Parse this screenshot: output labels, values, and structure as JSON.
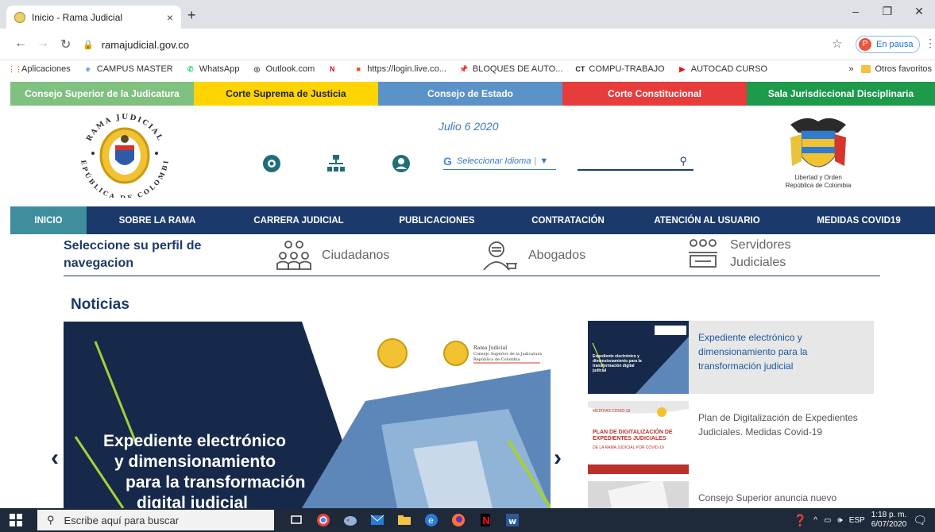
{
  "browser": {
    "tab_title": "Inicio - Rama Judicial",
    "tab_close": "×",
    "new_tab": "+",
    "url": "ramajudicial.gov.co",
    "profile_initial": "P",
    "profile_status": "En pausa",
    "window_controls": {
      "minimize": "–",
      "restore": "❐",
      "close": "✕"
    },
    "bookmarks": [
      {
        "label": "Aplicaciones",
        "icon": "apps-grid-icon",
        "color": "#e65a1e"
      },
      {
        "label": "CAMPUS MASTER",
        "icon": "edge-e-icon",
        "color": "#2a7bd6"
      },
      {
        "label": "WhatsApp",
        "icon": "whatsapp-icon",
        "color": "#25d366"
      },
      {
        "label": "Outlook.com",
        "icon": "globe-icon",
        "color": "#555555"
      },
      {
        "label": "",
        "icon": "netflix-icon",
        "color": "#e50914"
      },
      {
        "label": "https://login.live.co...",
        "icon": "microsoft-icon",
        "color": "#f25022"
      },
      {
        "label": "BLOQUES DE AUTO...",
        "icon": "pin-icon",
        "color": "#999999"
      },
      {
        "label": "COMPU-TRABAJO",
        "icon": "ct-icon",
        "color": "#222222"
      },
      {
        "label": "AUTOCAD CURSO",
        "icon": "youtube-icon",
        "color": "#ff0000"
      }
    ],
    "bookmarks_more": "»",
    "bookmarks_other": "Otros favoritos"
  },
  "corporations": [
    "Consejo Superior de la Judicatura",
    "Corte Suprema de Justicia",
    "Consejo de Estado",
    "Corte Constitucional",
    "Sala Jurisdiccional Disciplinaria"
  ],
  "header": {
    "seal_top_text": "RAMA JUDICIAL",
    "seal_bottom_text": "REPÚBLICA DE COLOMBIA",
    "date": "Julio 6 2020",
    "language_label": "Seleccionar Idioma",
    "language_caret": "▼",
    "escudo_caption_line1": "Libertad y Orden",
    "escudo_caption_line2": "República de Colombia"
  },
  "nav": [
    "INICIO",
    "SOBRE LA RAMA",
    "CARRERA JUDICIAL",
    "PUBLICACIONES",
    "CONTRATACIÓN",
    "ATENCIÓN AL USUARIO",
    "MEDIDAS COVID19"
  ],
  "perfil": {
    "title": "Seleccione su perfil de navegacion",
    "items": [
      "Ciudadanos",
      "Abogados",
      "Servidores Judiciales"
    ]
  },
  "noticias": {
    "title": "Noticias",
    "hero_lines": [
      "Expediente electrónico",
      "y dimensionamiento",
      "para la transformación",
      "digital judicial"
    ],
    "hero_logo_text": "Rama Judicial",
    "hero_logo_subtext": "Consejo Superior de la Judicatura",
    "hero_logo_subtext2": "República de Colombia",
    "prev_arrow": "‹",
    "next_arrow": "›",
    "items": [
      "Expediente electrónico y dimensionamiento para la transformación judicial",
      "Plan de Digitalización de Expedientes Judiciales. Medidas Covid-19",
      "Consejo Superior anuncia nuevo"
    ],
    "thumb1_text": "Expediente electrónico y dimensionamiento para la transformación digital judicial",
    "thumb2_small": "MEDIDAS COVID-19",
    "thumb2_text": "PLAN DE DIGITALIZACIÓN DE EXPEDIENTES JUDICIALES",
    "thumb2_sub": "DE LA RAMA JUDICIAL POR COVID-19"
  },
  "taskbar": {
    "search_placeholder": "Escribe aquí para buscar",
    "language": "ESP",
    "time": "1:18 p. m.",
    "date": "6/07/2020"
  },
  "colors": {
    "nav_bg": "#1b3a6b",
    "nav_active": "#3e8e9e",
    "link_blue": "#1b56a0"
  }
}
